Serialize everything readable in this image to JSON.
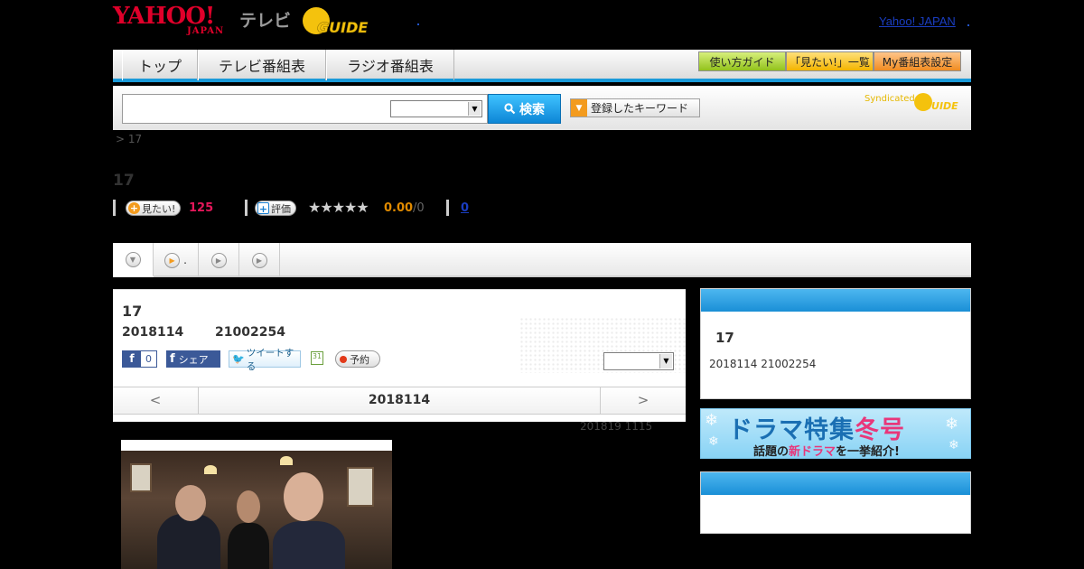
{
  "header": {
    "logo_text": "YAHOO!",
    "logo_sub": "JAPAN",
    "tv_label": "テレビ",
    "gguide_text": "GUIDE",
    "yahoo_japan_link": "Yahoo! JAPAN",
    "right_dot": ","
  },
  "nav": {
    "tabs": [
      "トップ",
      "テレビ番組表",
      "ラジオ番組表"
    ],
    "guide_btn": "使い方ガイド",
    "mitai_btn": "「見たい!」一覧",
    "my_btn": "My番組表設定"
  },
  "search": {
    "input_value": "",
    "select_value": "",
    "button_label": "検索",
    "keyword_button": "登録したキーワード",
    "syndicated": "Syndicated",
    "syndicated_logo": "GUIDE"
  },
  "breadcrumb": "> 17",
  "page_title": "17",
  "stats": {
    "mitai_label": "見たい!",
    "mitai_count": "125",
    "rating_label": "評価",
    "stars": "★★★★★",
    "score": "0.00",
    "score_count": "/0",
    "zero_link": "0"
  },
  "tabs": {
    "tab2_label": "."
  },
  "program": {
    "title": "17",
    "date": "2018114",
    "time": "21002254",
    "fb_count": "0",
    "fb_letter": "f",
    "fb_share": "シェア",
    "tweet": "ツイートする",
    "calendar": "31",
    "yoyaku": "予約",
    "select_value": ""
  },
  "pager": {
    "prev": "<",
    "date": "2018114",
    "next": ">"
  },
  "updated": "201819  1115",
  "sidebar": {
    "title": "17",
    "info": "2018114  21002254",
    "banner_main_a": "ドラマ特集",
    "banner_main_b": "冬号",
    "banner_sub_a": "話題の",
    "banner_sub_b": "新ドラマ",
    "banner_sub_c": "を一挙紹介!"
  },
  "colors": {
    "accent_blue": "#1a9ad9",
    "mitai_pink": "#e4175a",
    "score_orange": "#e08a00",
    "link_blue": "#1a3dc1"
  },
  "icons": {
    "search": "search-icon",
    "dropdown": "chevron-down-icon",
    "play": "play-icon",
    "calendar": "calendar-icon"
  }
}
